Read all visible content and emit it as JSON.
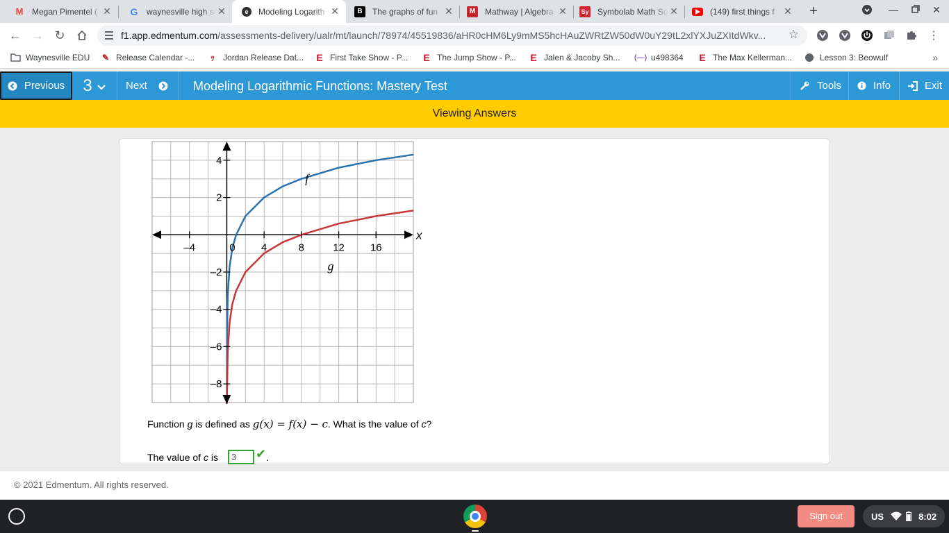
{
  "browser": {
    "tabs": [
      {
        "title": "Megan Pimentel (",
        "icon": "gmail-icon",
        "color": "#ea4335"
      },
      {
        "title": "waynesville high sc",
        "icon": "google-icon",
        "color": "#4285f4"
      },
      {
        "title": "Modeling Logarith",
        "icon": "edmentum-icon",
        "color": "#2c98d5"
      },
      {
        "title": "The graphs of fun",
        "icon": "brainly-icon",
        "color": "#000000"
      },
      {
        "title": "Mathway | Algebra",
        "icon": "mathway-icon",
        "color": "#c6262e"
      },
      {
        "title": "Symbolab Math So",
        "icon": "symbolab-icon",
        "color": "#d3232e"
      },
      {
        "title": "(149) first things f",
        "icon": "youtube-icon",
        "color": "#ff0000"
      }
    ],
    "url_host": "f1.app.edmentum.com",
    "url_path": "/assessments-delivery/ualr/mt/launch/78974/45519836/aHR0cHM6Ly9mMS5hcHAuZWRtZW50dW0uY29tL2xlYXJuZXItdWkv...",
    "bookmarks": [
      "Waynesville EDU",
      "Release Calendar -...",
      "Jordan Release Dat...",
      "First Take Show - P...",
      "The Jump Show - P...",
      "Jalen & Jacoby Sh...",
      "u498364",
      "The Max Kellerman...",
      "Lesson 3: Beowulf"
    ]
  },
  "header": {
    "previous": "Previous",
    "question_number": "3",
    "next": "Next",
    "title": "Modeling Logarithmic Functions: Mastery Test",
    "tools": "Tools",
    "info": "Info",
    "exit": "Exit"
  },
  "banner": "Viewing Answers",
  "chart_data": {
    "type": "line",
    "xlim": [
      -8,
      20
    ],
    "ylim": [
      -9,
      5
    ],
    "xticks": [
      -4,
      0,
      4,
      8,
      12,
      16
    ],
    "xtick_labels": [
      "–4",
      "0",
      "4",
      "8",
      "12",
      "16"
    ],
    "yticks": [
      4,
      2,
      -2,
      -4,
      -6,
      -8
    ],
    "ytick_labels": [
      "4",
      "2",
      "–2",
      "–4",
      "–6",
      "–8"
    ],
    "xlabel": "x",
    "grid": true,
    "series": [
      {
        "name": "f",
        "color": "#2b74b0",
        "x": [
          0.02,
          0.1,
          0.3,
          0.6,
          1,
          2,
          4,
          6,
          8,
          12,
          16,
          20
        ],
        "y": [
          -5.6,
          -3.3,
          -1.7,
          -0.7,
          0,
          1,
          2,
          2.6,
          3,
          3.6,
          4,
          4.3
        ]
      },
      {
        "name": "g",
        "color": "#c7373a",
        "x": [
          0.02,
          0.1,
          0.3,
          0.6,
          1,
          2,
          4,
          6,
          8,
          12,
          16,
          20
        ],
        "y": [
          -8.6,
          -6.3,
          -4.7,
          -3.7,
          -3,
          -2,
          -1,
          -0.4,
          0,
          0.6,
          1,
          1.3
        ]
      }
    ]
  },
  "question": {
    "text_before": "Function",
    "g_var": "g",
    "text_defined": "is defined as",
    "formula": "g(x) = f(x) − c",
    "text_after": ". What is the value of",
    "c_var": "c",
    "qmark": "?"
  },
  "answer": {
    "label_before": "The value of",
    "c_var": "c",
    "label_after": "is",
    "value": "3",
    "period": "."
  },
  "footer": "© 2021 Edmentum. All rights reserved.",
  "os": {
    "signout": "Sign out",
    "locale": "US",
    "time": "8:02"
  }
}
